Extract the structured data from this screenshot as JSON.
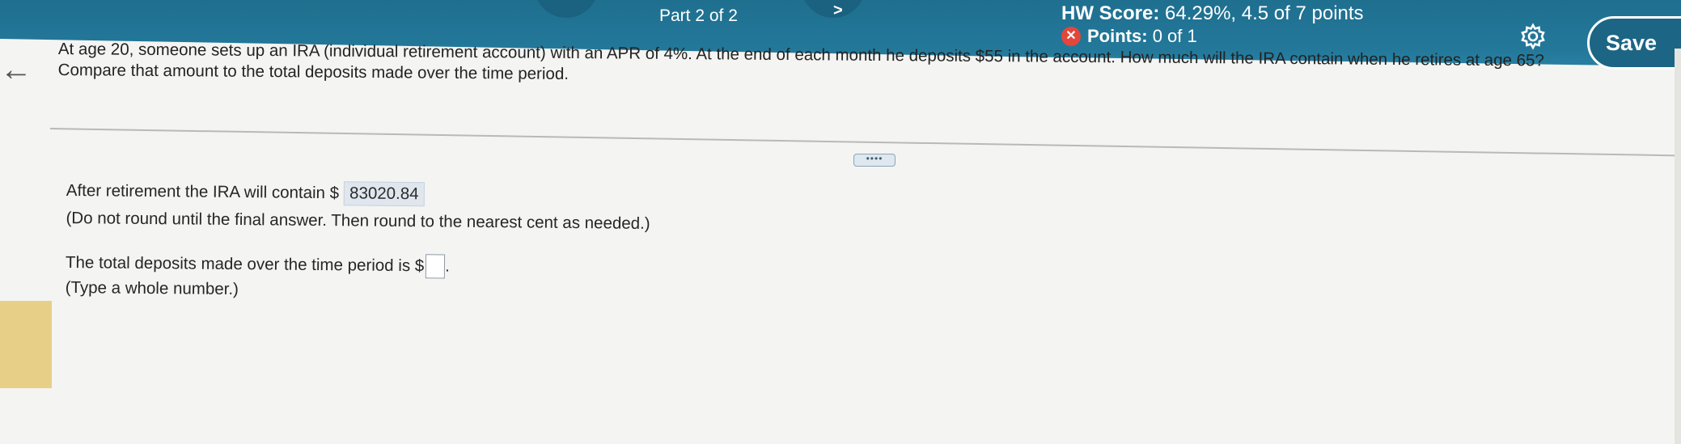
{
  "header": {
    "part_label": "Part 2 of 2",
    "next_chevron": ">",
    "hw_score_label": "HW Score:",
    "hw_score_value": "64.29%, 4.5 of 7 points",
    "points_label": "Points:",
    "points_value": "0 of 1",
    "points_status_icon": "x-circle-icon",
    "settings_icon": "gear-icon",
    "save_label": "Save"
  },
  "question": {
    "line1": "At age 20, someone sets up an IRA (individual retirement account) with an APR of 4%. At the end of each month he deposits $55 in the account. How much will the IRA contain when he retires at age 65?",
    "line2": "Compare that amount to the total deposits made over the time period."
  },
  "more_button_label": "••••",
  "answers": {
    "part1_prefix": "After retirement the IRA will contain $",
    "part1_value": "83020.84",
    "part1_note": "(Do not round until the final answer. Then round to the nearest cent as needed.)",
    "part2_prefix": "The total deposits made over the time period is $",
    "part2_value": "",
    "part2_suffix": ".",
    "part2_note": "(Type a whole number.)"
  },
  "colors": {
    "header": "#23789a",
    "status_error": "#e2473b",
    "answer_highlight": "#dfe6ee"
  }
}
